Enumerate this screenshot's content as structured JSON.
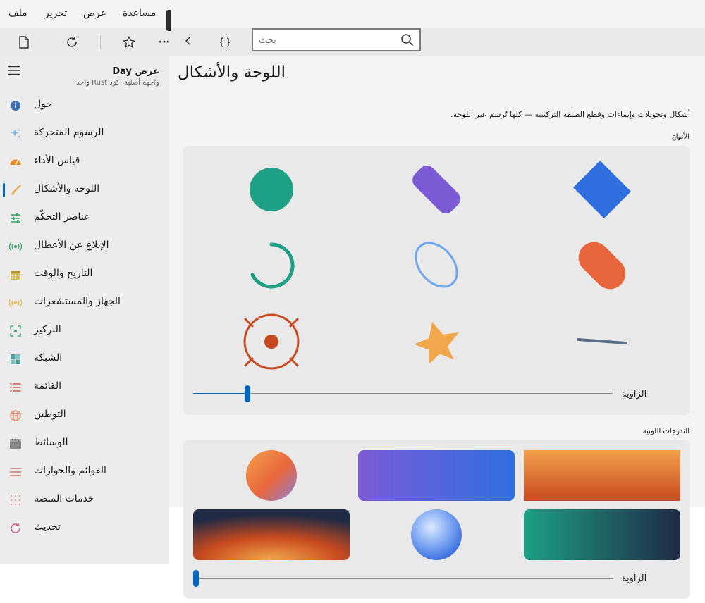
{
  "menu": {
    "file": "ملف",
    "edit": "تحرير",
    "view": "عرض",
    "help": "مساعدة"
  },
  "toolbar": {
    "icons": [
      "new-page-icon",
      "refresh-icon",
      "star-icon",
      "more-icon",
      "chevron-left-icon",
      "braces-icon"
    ],
    "more_label": "···",
    "search_placeholder": "بحث"
  },
  "app": {
    "title": "عرض Day",
    "subtitle": "واجهة أصلية، كود Rust واحد"
  },
  "sidebar": {
    "items": [
      {
        "label": "حول",
        "icon": "info-icon",
        "color": "#3d6fb5"
      },
      {
        "label": "الرسوم المتحركة",
        "icon": "sparkles-icon",
        "color": "#7ab8e6"
      },
      {
        "label": "قياس الأداء",
        "icon": "gauge-icon",
        "color": "#f0851c"
      },
      {
        "label": "اللوحة والأشكال",
        "icon": "brush-icon",
        "color": "#f2a44a"
      },
      {
        "label": "عناصر التحكّم",
        "icon": "sliders-icon",
        "color": "#3aa56a"
      },
      {
        "label": "الإبلاغ عن الأعطال",
        "icon": "broadcast-icon",
        "color": "#3aa56a"
      },
      {
        "label": "التاريخ والوقت",
        "icon": "calendar-icon",
        "color": "#b8962e"
      },
      {
        "label": "الجهاز والمستشعرات",
        "icon": "sensor-icon",
        "color": "#e8b24a"
      },
      {
        "label": "التركيز",
        "icon": "focus-icon",
        "color": "#3aa56a"
      },
      {
        "label": "الشبكة",
        "icon": "grid-icon",
        "color": "#4aa3a0"
      },
      {
        "label": "القائمة",
        "icon": "list-icon",
        "color": "#d9534f"
      },
      {
        "label": "التوطين",
        "icon": "globe-icon",
        "color": "#e8896a"
      },
      {
        "label": "الوسائط",
        "icon": "clapper-icon",
        "color": "#888888"
      },
      {
        "label": "القوائم والحوارات",
        "icon": "menu-lines-icon",
        "color": "#d9534f"
      },
      {
        "label": "خدمات المنصة",
        "icon": "dots-grid-icon",
        "color": "#e8a0a0"
      },
      {
        "label": "تحديث",
        "icon": "update-icon",
        "color": "#c45a8a"
      }
    ]
  },
  "main": {
    "title": "اللوحة والأشكال",
    "description": "أشكال وتحويلات وإيماءات وقطع الطبقة التركيبية — كلها تُرسم عبر اللوحة.",
    "shapes_section": "الأنواع",
    "gradients_section": "التدرجات اللونية",
    "angle_label": "الزاوية",
    "shapes_slider_value": 0.13,
    "gradients_slider_value": 0.0
  },
  "colors": {
    "accent": "#0067c0",
    "teal": "#1ea085",
    "purple": "#7b5bd6",
    "blue": "#2f6fe0",
    "orange": "#e8663c",
    "light_blue": "#6ea6f0",
    "rust": "#c84a20",
    "amber": "#f2a84a",
    "slate": "#5e7088"
  }
}
